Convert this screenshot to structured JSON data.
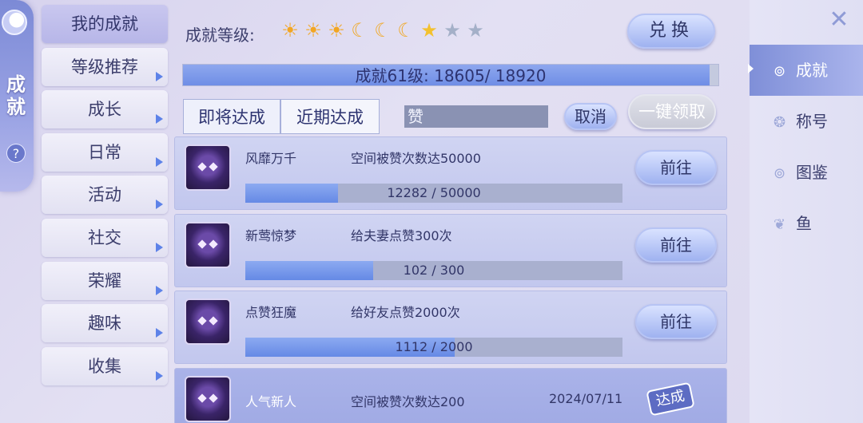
{
  "side": {
    "title": "成就",
    "help": "?"
  },
  "menu": [
    {
      "label": "我的成就",
      "active": true
    },
    {
      "label": "等级推荐"
    },
    {
      "label": "成长"
    },
    {
      "label": "日常"
    },
    {
      "label": "活动"
    },
    {
      "label": "社交"
    },
    {
      "label": "荣耀"
    },
    {
      "label": "趣味"
    },
    {
      "label": "收集"
    }
  ],
  "header": {
    "rank_label": "成就等级:",
    "stars": [
      "sun",
      "sun",
      "sun",
      "moon",
      "moon",
      "moon",
      "star",
      "empty-star",
      "empty-star"
    ],
    "exchange": "兑换"
  },
  "level": {
    "text": "成就61级: 18605/ 18920",
    "current": 18605,
    "max": 18920
  },
  "tabs": {
    "upcoming": "即将达成",
    "recent": "近期达成"
  },
  "search": {
    "value": "赞",
    "cancel": "取消",
    "claim_all": "一键领取"
  },
  "achievements": [
    {
      "name": "风靡万千",
      "desc": "空间被赞次数达50000",
      "progress_text": "12282 /  50000",
      "current": 12282,
      "max": 50000,
      "button": "前往"
    },
    {
      "name": "新莺惊梦",
      "desc": "给夫妻点赞300次",
      "progress_text": "102 /  300",
      "current": 102,
      "max": 300,
      "button": "前往"
    },
    {
      "name": "点赞狂魔",
      "desc": "给好友点赞2000次",
      "progress_text": "1112 /  2000",
      "current": 1112,
      "max": 2000,
      "button": "前往"
    },
    {
      "name": "人气新人",
      "desc": "空间被赞次数达200",
      "date": "2024/07/11",
      "status": "达成"
    }
  ],
  "right_tabs": [
    {
      "label": "成就",
      "icon": "rings-icon",
      "active": true
    },
    {
      "label": "称号",
      "icon": "badge-icon"
    },
    {
      "label": "图鉴",
      "icon": "rings-icon"
    },
    {
      "label": "鱼",
      "icon": "fish-icon"
    }
  ],
  "colors": {
    "accent": "#6f8ee6",
    "active_tab": "#7f8fd8",
    "star_gold": "#f3c12e"
  }
}
